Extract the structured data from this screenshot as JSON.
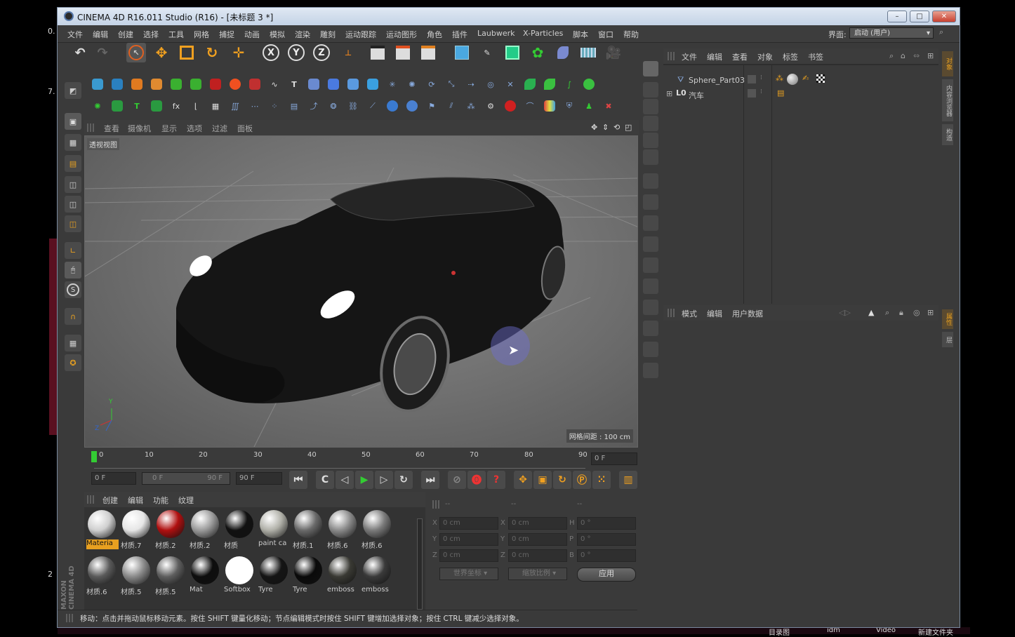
{
  "desktop": {
    "left_labels": [
      "0.",
      "7.",
      "2"
    ],
    "bottom_labels": [
      "目录图",
      "idm",
      "Video",
      "新建文件夹"
    ]
  },
  "window": {
    "title": "CINEMA 4D R16.011 Studio (R16) - [未标题 3 *]",
    "controls": {
      "minimize": "–",
      "maximize": "□",
      "close": "✕"
    }
  },
  "menu": {
    "items": [
      "文件",
      "编辑",
      "创建",
      "选择",
      "工具",
      "网格",
      "捕捉",
      "动画",
      "模拟",
      "渲染",
      "雕刻",
      "运动跟踪",
      "运动图形",
      "角色",
      "插件",
      "Laubwerk",
      "X-Particles",
      "脚本",
      "窗口",
      "帮助"
    ],
    "interface_label": "界面:",
    "interface_value": "启动 (用户)"
  },
  "toolbar": {
    "axis_x": "X",
    "axis_y": "Y",
    "axis_z": "Z"
  },
  "viewport": {
    "menus": [
      "查看",
      "摄像机",
      "显示",
      "选项",
      "过滤",
      "面板"
    ],
    "label": "透视视图",
    "grid_spacing": "网格间距 : 100 cm",
    "axis_labels": {
      "y": "Y",
      "z": "Z"
    }
  },
  "timeline": {
    "ticks": [
      "0",
      "10",
      "20",
      "30",
      "40",
      "50",
      "60",
      "70",
      "80",
      "90"
    ],
    "current_frame": "0 F",
    "start_field": "0 F",
    "range_start": "0 F",
    "range_end": "90 F",
    "end_field": "90 F"
  },
  "materials": {
    "menus": [
      "创建",
      "编辑",
      "功能",
      "纹理"
    ],
    "row1": [
      {
        "name": "Materia",
        "color": "#cfcfcf",
        "selected": true
      },
      {
        "name": "材质.7",
        "color": "#e6e6e6"
      },
      {
        "name": "材质.2",
        "color": "#b01010"
      },
      {
        "name": "材质.2",
        "color": "#9a9a9a"
      },
      {
        "name": "材质",
        "color": "#111111"
      },
      {
        "name": "paint ca",
        "color": "#b0b0a8"
      },
      {
        "name": "材质.1",
        "color": "#6a6a6a"
      },
      {
        "name": "材质.6",
        "color": "#8a8a8a"
      },
      {
        "name": "材质.6",
        "color": "#7a7a7a"
      }
    ],
    "row2": [
      {
        "name": "材质.6",
        "color": "#5a5a5a"
      },
      {
        "name": "材质.5",
        "color": "#8a8a8a"
      },
      {
        "name": "材质.5",
        "color": "#5e5e5e"
      },
      {
        "name": "Mat",
        "color": "#0d0d0d"
      },
      {
        "name": "Softbox",
        "color": "#ffffff"
      },
      {
        "name": "Tyre",
        "color": "#151515"
      },
      {
        "name": "Tyre",
        "color": "#0a0a0a"
      },
      {
        "name": "emboss",
        "color": "#3a3a34"
      },
      {
        "name": "emboss",
        "color": "#3a3a3a"
      }
    ]
  },
  "coords": {
    "headers": [
      "--",
      "--",
      "--"
    ],
    "rows": [
      {
        "l1": "X",
        "v1": "0 cm",
        "l2": "X",
        "v2": "0 cm",
        "l3": "H",
        "v3": "0 °"
      },
      {
        "l1": "Y",
        "v1": "0 cm",
        "l2": "Y",
        "v2": "0 cm",
        "l3": "P",
        "v3": "0 °"
      },
      {
        "l1": "Z",
        "v1": "0 cm",
        "l2": "Z",
        "v2": "0 cm",
        "l3": "B",
        "v3": "0 °"
      }
    ],
    "world": "世界坐标",
    "scale": "缩放比例",
    "apply": "应用"
  },
  "objects": {
    "menus": [
      "文件",
      "编辑",
      "查看",
      "对象",
      "标签",
      "书签"
    ],
    "items": [
      {
        "name": "Sphere_Part03"
      },
      {
        "name": "汽车"
      }
    ]
  },
  "attributes": {
    "menus": [
      "模式",
      "编辑",
      "用户数据"
    ]
  },
  "right_tabs": [
    "对象",
    "内容浏览器",
    "构造",
    "属性",
    "层"
  ],
  "status": "移动：点击并拖动鼠标移动元素。按住 SHIFT 键量化移动；节点编辑模式时按住 SHIFT 键增加选择对象；按住 CTRL 键减少选择对象。",
  "brand": "MAXON CINEMA 4D"
}
